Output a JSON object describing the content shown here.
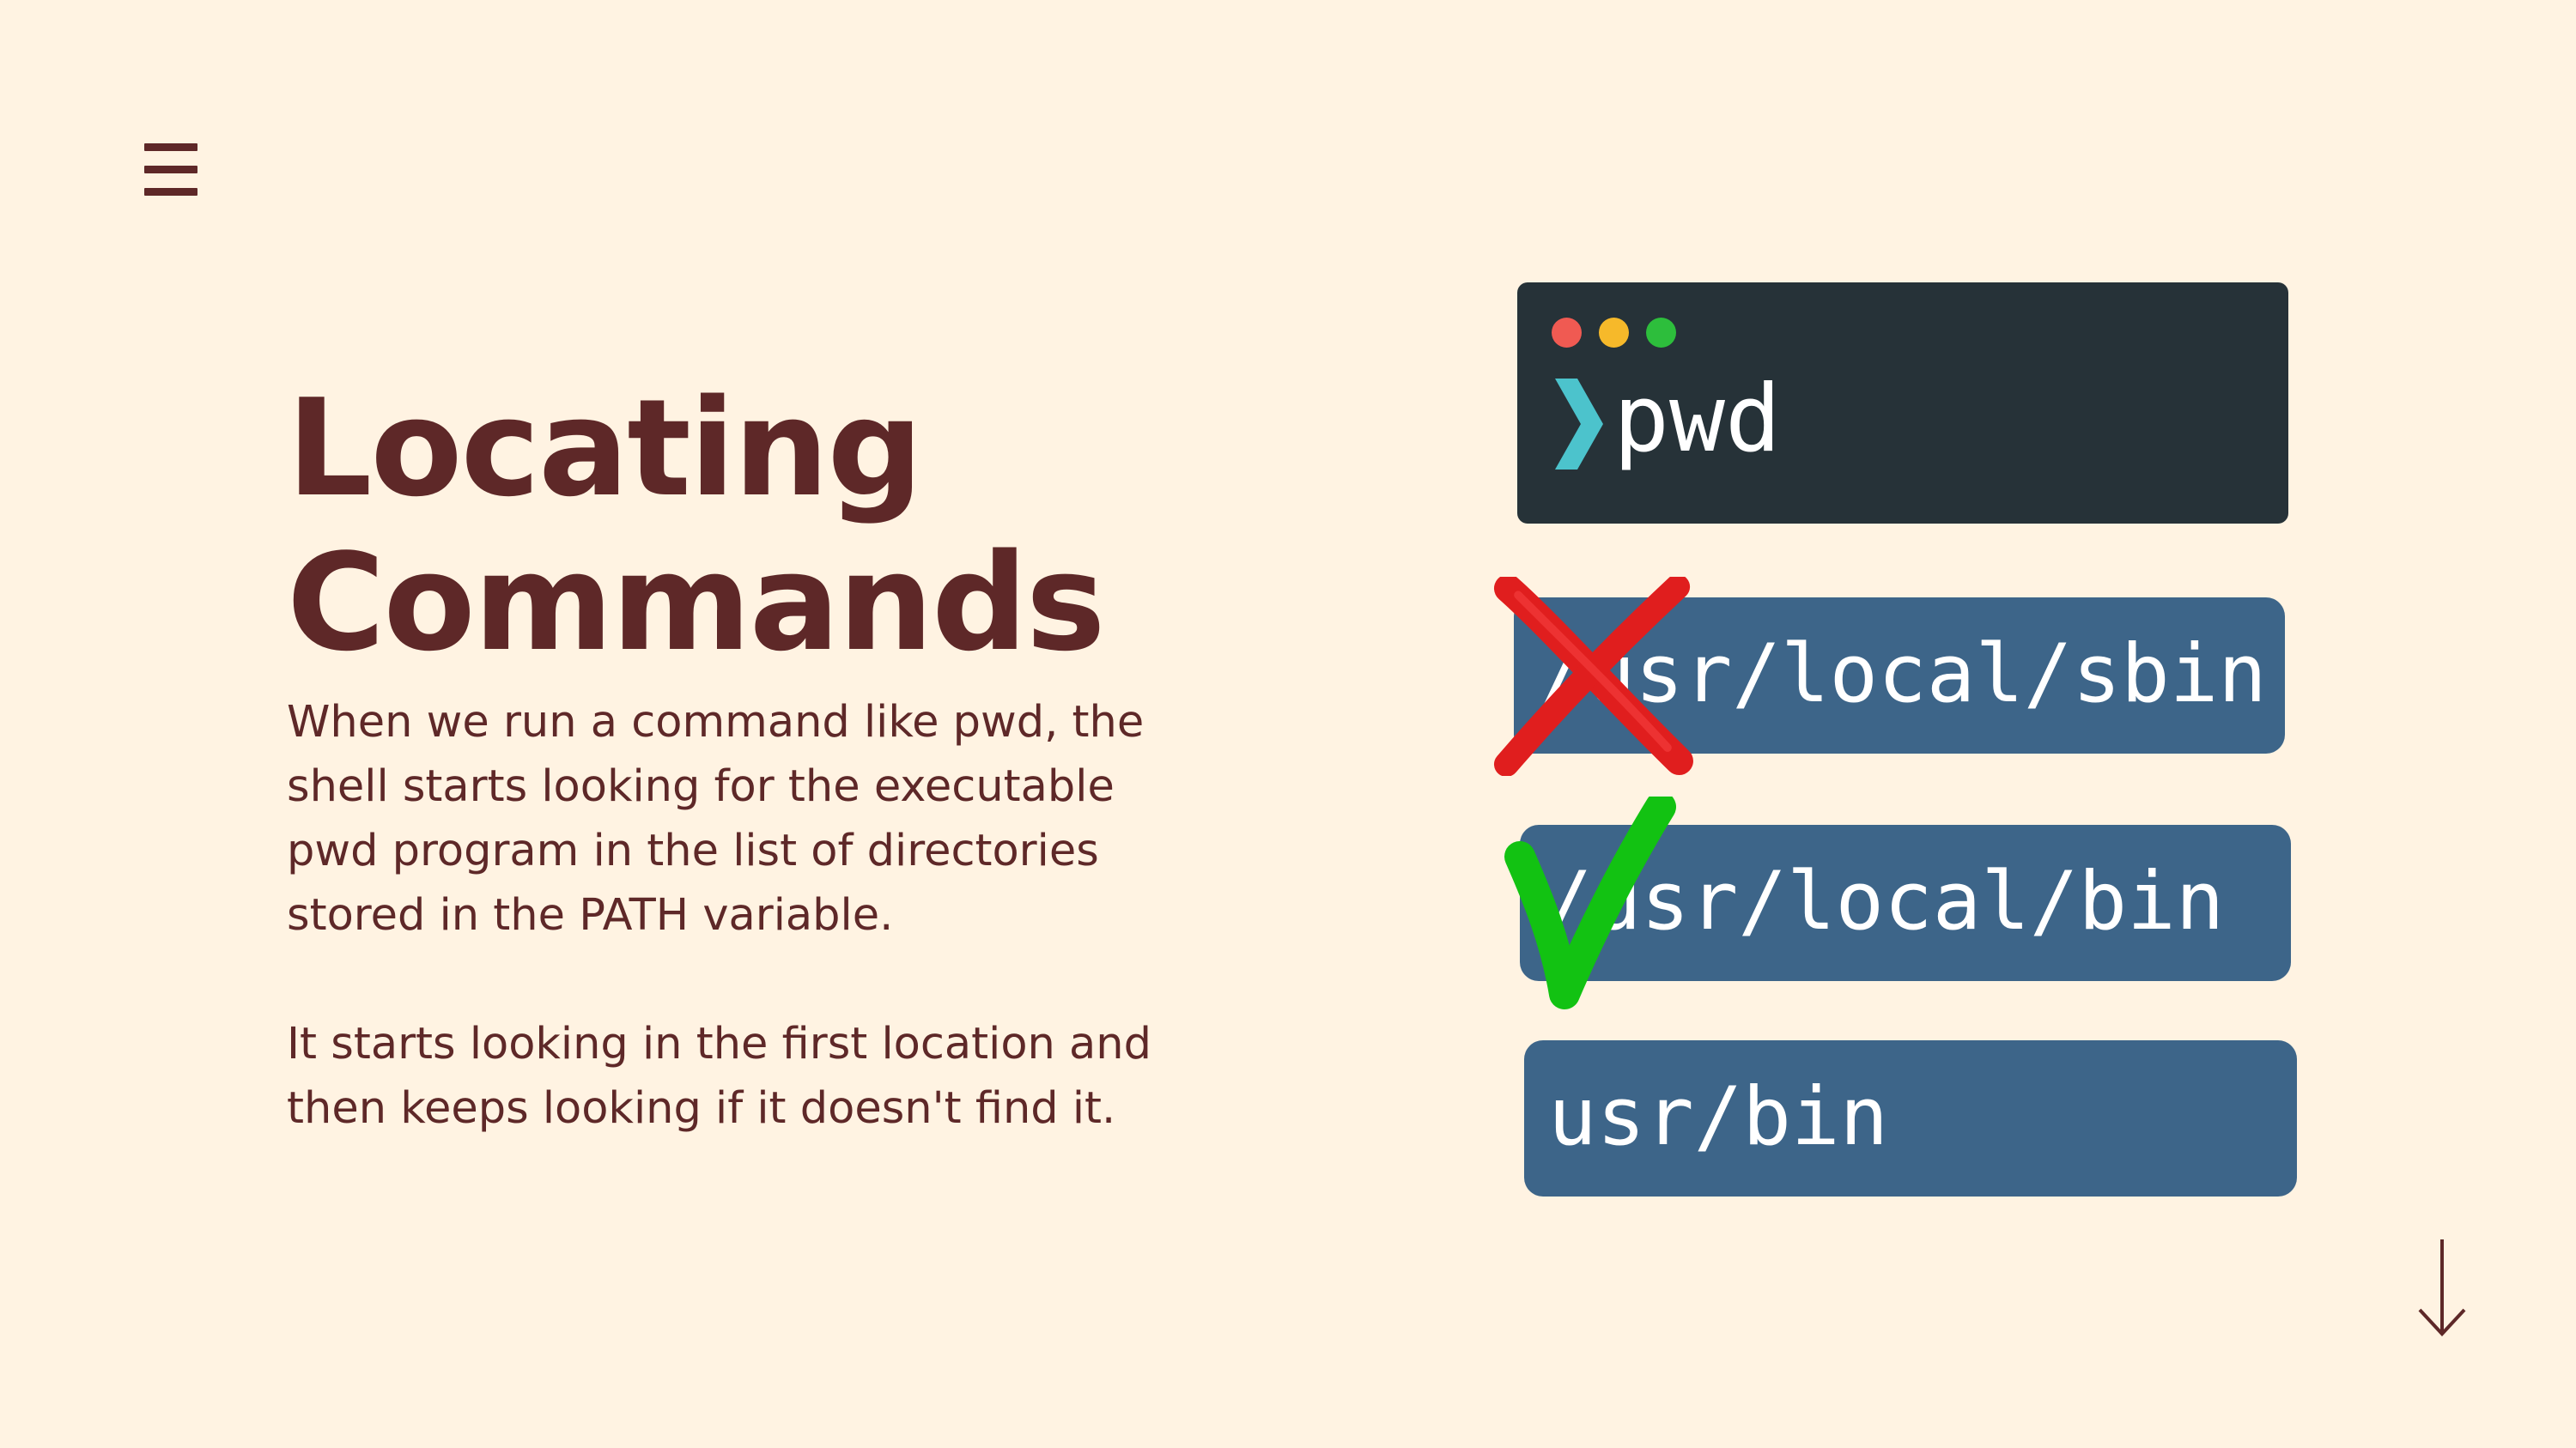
{
  "colors": {
    "background": "#FFF3E2",
    "text": "#5E2828",
    "terminal_bg": "#263238",
    "path_box_bg": "#3D6589",
    "prompt_chevron": "#4CC3CC",
    "dot_red": "#F05A52",
    "dot_yellow": "#F6B92A",
    "dot_green": "#2DBE3C",
    "cross_mark": "#E01E1E",
    "check_mark": "#12C212"
  },
  "header": {
    "menu_icon": "hamburger-menu-icon"
  },
  "slide": {
    "title_line1": "Locating",
    "title_line2": "Commands",
    "paragraph1": "When we run a command like pwd, the shell starts looking for the executable pwd program in the list of directories stored in the PATH variable.",
    "paragraph2": "It starts looking in the first location and then keeps looking if it doesn't find it."
  },
  "terminal": {
    "prompt_icon": "chevron-right-icon",
    "command": "pwd"
  },
  "paths": [
    {
      "text": "/usr/local/sbin",
      "status": "not-found",
      "mark_icon": "red-cross-icon"
    },
    {
      "text": "/usr/local/bin",
      "status": "found",
      "mark_icon": "green-check-icon"
    },
    {
      "text": "usr/bin",
      "status": "unchecked"
    }
  ],
  "navigation": {
    "next_icon": "arrow-down-icon"
  }
}
